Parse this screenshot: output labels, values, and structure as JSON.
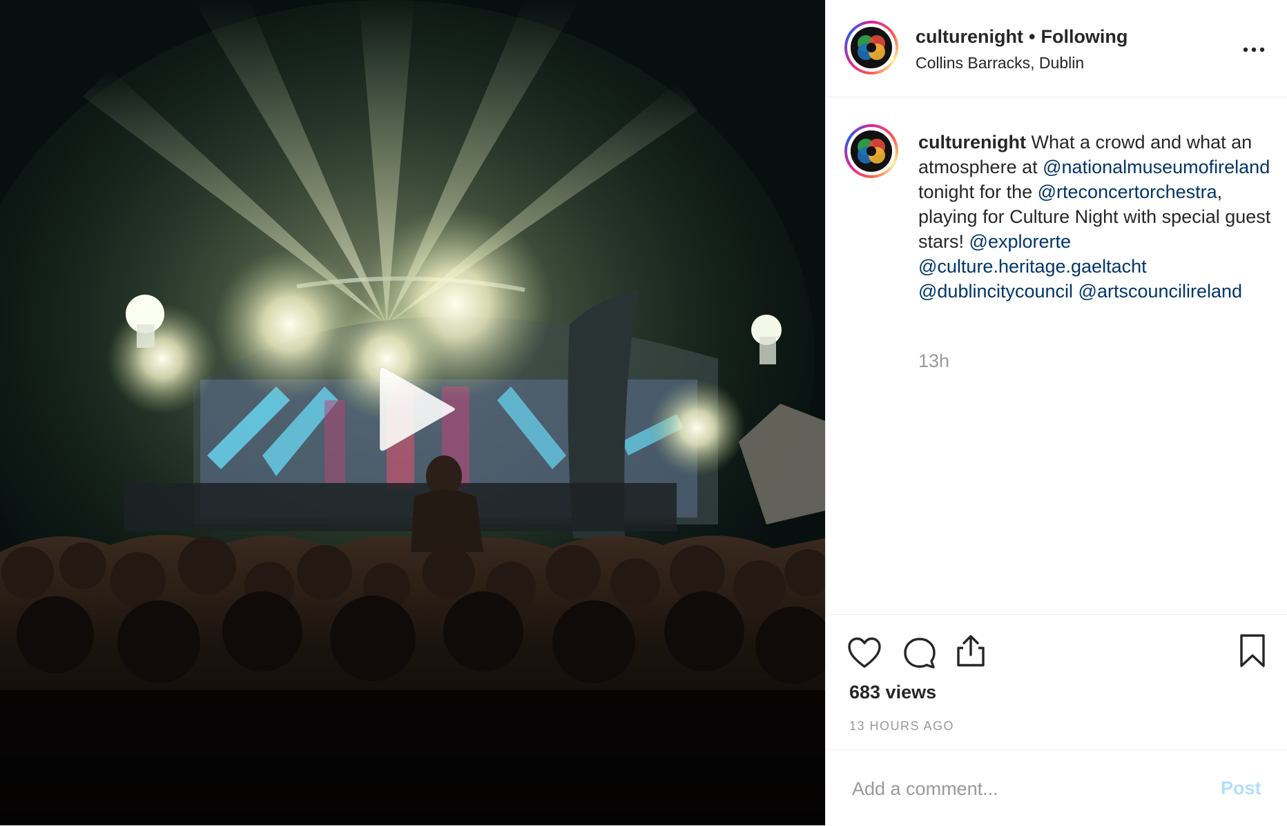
{
  "post": {
    "username": "culturenight",
    "follow_status": "Following",
    "location": "Collins Barracks, Dublin"
  },
  "caption": {
    "username": "culturenight",
    "text_1": "What a crowd and what an atmosphere at",
    "mention_1": "@nationalmuseumofireland",
    "text_2": "tonight for the",
    "mention_2": "@rteconcertorchestra",
    "text_3": ", playing for Culture Night with special guest stars!",
    "mention_3": "@explorerte",
    "mention_4": "@culture.heritage.gaeltacht",
    "mention_5": "@dublincitycouncil",
    "mention_6": "@artscouncilireland",
    "time_ago": "13h"
  },
  "stats": {
    "views": "683 views",
    "timestamp": "13 HOURS AGO"
  },
  "comment": {
    "placeholder": "Add a comment...",
    "post_label": "Post"
  },
  "icons": {
    "like": "heart-icon",
    "comment": "comment-icon",
    "share": "share-icon",
    "save": "bookmark-icon",
    "more": "more-options-icon",
    "play": "play-icon"
  },
  "colors": {
    "mention": "#003569",
    "muted": "#999999",
    "post_disabled": "#b2dffc",
    "border": "#efefef"
  }
}
